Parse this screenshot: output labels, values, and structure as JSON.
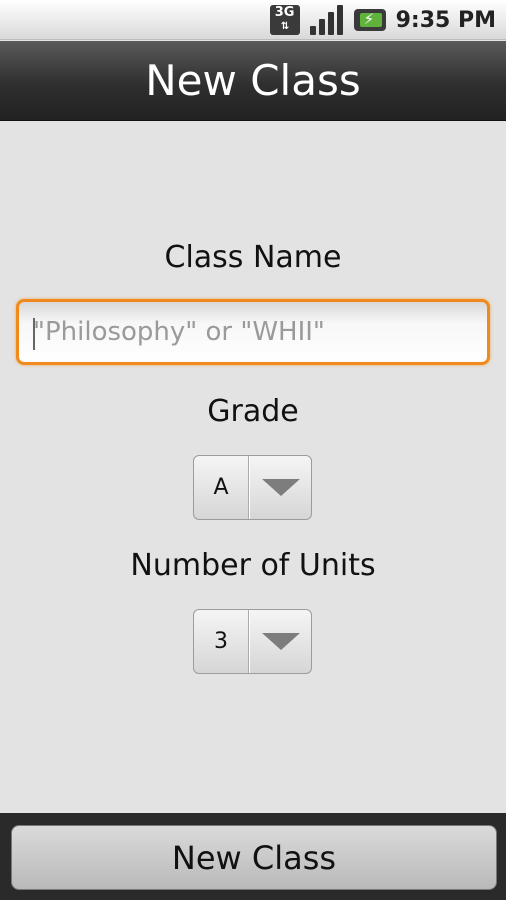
{
  "status_bar": {
    "network_label": "3G",
    "time": "9:35 PM",
    "icons": [
      "3g-data-icon",
      "signal-icon",
      "battery-charging-icon"
    ]
  },
  "header": {
    "title": "New Class"
  },
  "form": {
    "class_name_label": "Class Name",
    "class_name_placeholder": "\"Philosophy\" or \"WHII\"",
    "class_name_value": "",
    "grade_label": "Grade",
    "grade_value": "A",
    "units_label": "Number of Units",
    "units_value": "3"
  },
  "footer": {
    "button_label": "New Class"
  },
  "colors": {
    "focus": "#f08a1c",
    "title_bar": "#2f2f2f",
    "background": "#e3e3e3"
  }
}
